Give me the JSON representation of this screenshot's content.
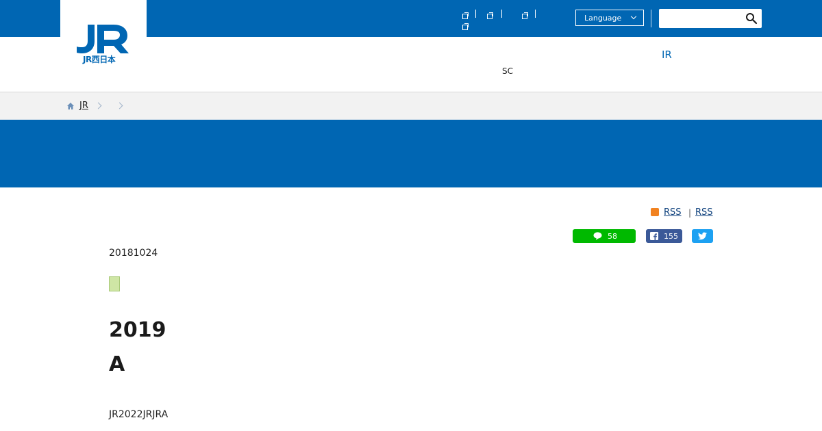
{
  "header": {
    "logo_caption": "JR西日本",
    "language_label": "Language",
    "search_placeholder": ""
  },
  "nav": {
    "sc_label": "SC",
    "ir_label": "IR"
  },
  "breadcrumb": {
    "home_label": "JR"
  },
  "rss": {
    "link1": "RSS",
    "separator": "|",
    "link2": "RSS"
  },
  "share": {
    "line_count": "58",
    "facebook_count": "155"
  },
  "article": {
    "date": "20181024",
    "headline_line1": "2019",
    "headline_line2": "A",
    "body": "JR2022JRJRA"
  },
  "colors": {
    "brand_blue": "#0066b3",
    "line_green": "#00b900",
    "facebook_blue": "#3b5998",
    "twitter_blue": "#1da1f2",
    "rss_orange": "#f18220"
  },
  "icons": [
    "jr-logo",
    "external-link-icon",
    "chevron-down-icon",
    "search-icon",
    "home-icon",
    "chevron-right-icon",
    "rss-icon",
    "line-icon",
    "facebook-icon",
    "twitter-icon"
  ]
}
